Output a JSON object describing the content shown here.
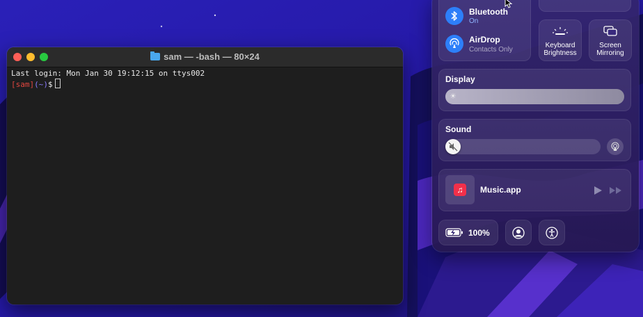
{
  "terminal": {
    "title": "sam — -bash — 80×24",
    "last_login": "Last login: Mon Jan 30 19:12:15 on ttys002",
    "prompt_user": "[sam]",
    "prompt_dir": "(~)",
    "prompt_symbol": "$"
  },
  "control_center": {
    "bluetooth": {
      "label": "Bluetooth",
      "status": "On"
    },
    "airdrop": {
      "label": "AirDrop",
      "status": "Contacts Only"
    },
    "keyboard_brightness": {
      "line1": "Keyboard",
      "line2": "Brightness"
    },
    "screen_mirroring": {
      "line1": "Screen",
      "line2": "Mirroring"
    },
    "display": {
      "title": "Display",
      "brightness": 1.0
    },
    "sound": {
      "title": "Sound",
      "volume": 0.0
    },
    "now_playing": {
      "app": "Music.app"
    },
    "battery": {
      "percent": "100%"
    }
  },
  "colors": {
    "wallpaper": "#2a1fb0",
    "accent_blue": "#2d7ff9",
    "music_red": "#f2304a"
  }
}
